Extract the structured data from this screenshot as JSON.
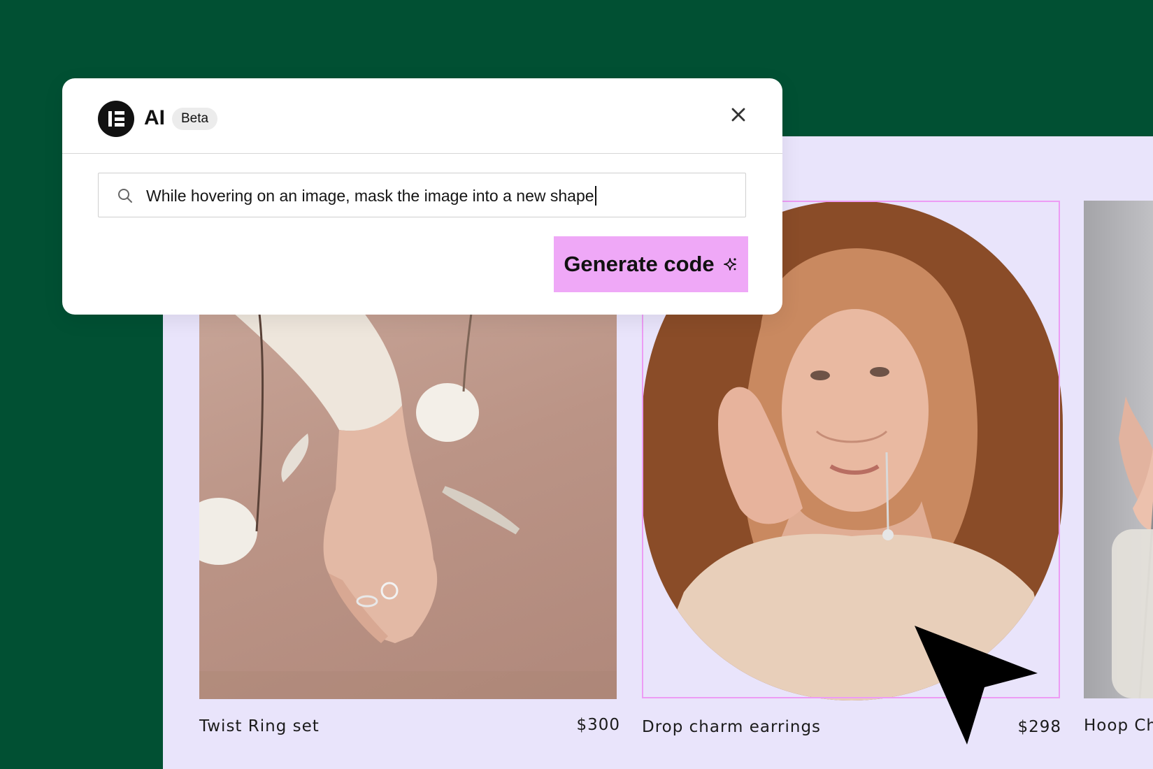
{
  "dialog": {
    "title": "AI",
    "badge": "Beta",
    "prompt_text": "While hovering on an image, mask the image into a new shape",
    "generate_label": "Generate code",
    "icons": {
      "logo": "elementor-logo",
      "close": "close-icon",
      "search": "search-icon",
      "generate": "sparkle-icon"
    }
  },
  "products": [
    {
      "name": "Twist Ring set",
      "price": "$300"
    },
    {
      "name": "Drop charm earrings",
      "price": "$298"
    },
    {
      "name": "Hoop Ch",
      "price": ""
    }
  ],
  "colors": {
    "background": "#015033",
    "canvas": "#e9e4fb",
    "accent": "#efa8f7",
    "selection": "#ed9cf4"
  }
}
